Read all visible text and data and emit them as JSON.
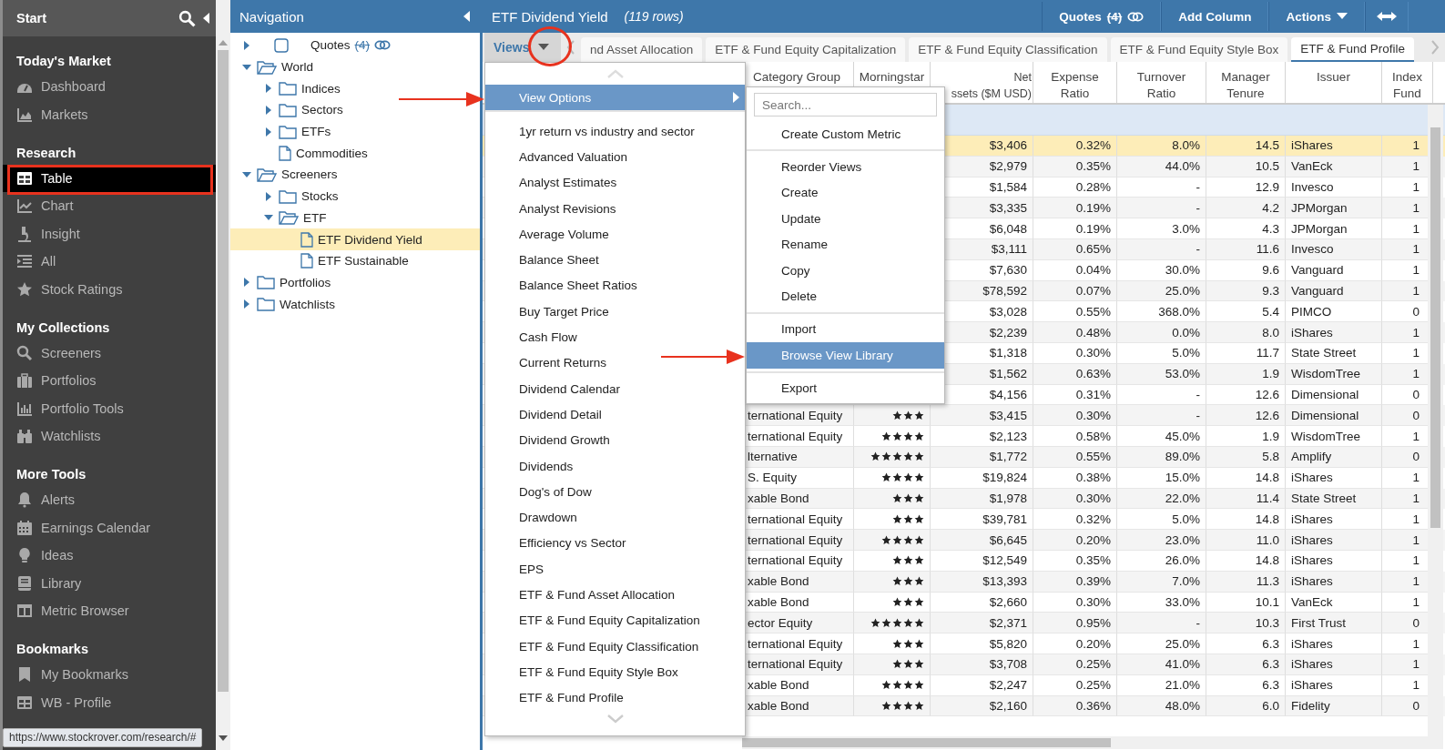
{
  "sidebar": {
    "title": "Start",
    "sections": [
      {
        "heading": "Today's Market",
        "items": [
          {
            "label": "Dashboard",
            "selected": false
          },
          {
            "label": "Markets",
            "selected": false
          }
        ]
      },
      {
        "heading": "Research",
        "items": [
          {
            "label": "Table",
            "selected": true
          },
          {
            "label": "Chart",
            "selected": false
          },
          {
            "label": "Insight",
            "selected": false
          },
          {
            "label": "All",
            "selected": false
          },
          {
            "label": "Stock Ratings",
            "selected": false
          }
        ]
      },
      {
        "heading": "My Collections",
        "items": [
          {
            "label": "Screeners",
            "selected": false
          },
          {
            "label": "Portfolios",
            "selected": false
          },
          {
            "label": "Portfolio Tools",
            "selected": false
          },
          {
            "label": "Watchlists",
            "selected": false
          }
        ]
      },
      {
        "heading": "More Tools",
        "items": [
          {
            "label": "Alerts",
            "selected": false
          },
          {
            "label": "Earnings Calendar",
            "selected": false
          },
          {
            "label": "Ideas",
            "selected": false
          },
          {
            "label": "Library",
            "selected": false
          },
          {
            "label": "Metric Browser",
            "selected": false
          }
        ]
      },
      {
        "heading": "Bookmarks",
        "items": [
          {
            "label": "My Bookmarks",
            "selected": false
          },
          {
            "label": "WB - Profile",
            "selected": false
          }
        ]
      }
    ]
  },
  "status_url": "https://www.stockrover.com/research/#",
  "navigation": {
    "title": "Navigation",
    "tree": [
      {
        "kind": "quotes",
        "label": "Quotes",
        "count": "(4)",
        "checked": false,
        "expanded": false,
        "selected": false
      },
      {
        "kind": "folder",
        "label": "World",
        "expanded": true,
        "selected": false,
        "children": [
          {
            "kind": "folder",
            "label": "Indices",
            "expanded": false,
            "selected": false
          },
          {
            "kind": "folder",
            "label": "Sectors",
            "expanded": false,
            "selected": false
          },
          {
            "kind": "folder",
            "label": "ETFs",
            "expanded": false,
            "selected": false
          },
          {
            "kind": "file",
            "label": "Commodities",
            "selected": false
          }
        ]
      },
      {
        "kind": "folder",
        "label": "Screeners",
        "expanded": true,
        "selected": false,
        "children": [
          {
            "kind": "folder",
            "label": "Stocks",
            "expanded": false,
            "selected": false
          },
          {
            "kind": "folder",
            "label": "ETF",
            "expanded": true,
            "selected": false,
            "children": [
              {
                "kind": "file",
                "label": "ETF Dividend Yield",
                "selected": true
              },
              {
                "kind": "file",
                "label": "ETF Sustainable",
                "selected": false
              }
            ]
          }
        ]
      },
      {
        "kind": "folder",
        "label": "Portfolios",
        "expanded": false,
        "selected": false
      },
      {
        "kind": "folder",
        "label": "Watchlists",
        "expanded": false,
        "selected": false
      }
    ]
  },
  "main": {
    "title": "ETF Dividend Yield",
    "row_count": "(119 rows)",
    "buttons": [
      {
        "kind": "quotes",
        "label": "Quotes",
        "count": "(4)"
      },
      {
        "kind": "plain",
        "label": "Add Column"
      },
      {
        "kind": "dropdown",
        "label": "Actions"
      },
      {
        "kind": "expand"
      }
    ]
  },
  "views_button": {
    "label": "Views"
  },
  "view_tabs": [
    {
      "label": "nd Asset Allocation",
      "selected": false
    },
    {
      "label": "ETF & Fund Equity Capitalization",
      "selected": false
    },
    {
      "label": "ETF & Fund Equity Classification",
      "selected": false
    },
    {
      "label": "ETF & Fund Equity Style Box",
      "selected": false
    },
    {
      "label": "ETF & Fund Profile",
      "selected": true
    }
  ],
  "table": {
    "columns": [
      {
        "lines": [
          "Category Group"
        ]
      },
      {
        "lines": [
          "Morningstar"
        ]
      },
      {
        "lines": [
          "Net",
          "ssets ($M USD)"
        ]
      },
      {
        "lines": [
          "Expense",
          "Ratio"
        ]
      },
      {
        "lines": [
          "Turnover",
          "Ratio"
        ]
      },
      {
        "lines": [
          "Manager",
          "Tenure"
        ]
      },
      {
        "lines": [
          "Issuer"
        ]
      },
      {
        "lines": [
          "Index",
          "Fund"
        ]
      }
    ],
    "rows": [
      {
        "selected": true,
        "net_assets": "$3,406",
        "expense": "0.32%",
        "turnover": "8.0%",
        "tenure": "14.5",
        "issuer": "iShares",
        "index": "1"
      },
      {
        "selected": false,
        "net_assets": "$2,979",
        "expense": "0.35%",
        "turnover": "44.0%",
        "tenure": "10.5",
        "issuer": "VanEck",
        "index": "1"
      },
      {
        "selected": false,
        "net_assets": "$1,584",
        "expense": "0.28%",
        "turnover": "-",
        "tenure": "12.9",
        "issuer": "Invesco",
        "index": "1"
      },
      {
        "selected": false,
        "net_assets": "$3,335",
        "expense": "0.19%",
        "turnover": "-",
        "tenure": "4.2",
        "issuer": "JPMorgan",
        "index": "1"
      },
      {
        "selected": false,
        "net_assets": "$6,048",
        "expense": "0.19%",
        "turnover": "3.0%",
        "tenure": "4.3",
        "issuer": "JPMorgan",
        "index": "1"
      },
      {
        "selected": false,
        "net_assets": "$3,111",
        "expense": "0.65%",
        "turnover": "-",
        "tenure": "11.6",
        "issuer": "Invesco",
        "index": "1"
      },
      {
        "selected": false,
        "net_assets": "$7,630",
        "expense": "0.04%",
        "turnover": "30.0%",
        "tenure": "9.6",
        "issuer": "Vanguard",
        "index": "1"
      },
      {
        "selected": false,
        "net_assets": "$78,592",
        "expense": "0.07%",
        "turnover": "25.0%",
        "tenure": "9.3",
        "issuer": "Vanguard",
        "index": "1"
      },
      {
        "selected": false,
        "net_assets": "$3,028",
        "expense": "0.55%",
        "turnover": "368.0%",
        "tenure": "5.4",
        "issuer": "PIMCO",
        "index": "0"
      },
      {
        "selected": false,
        "net_assets": "$2,239",
        "expense": "0.48%",
        "turnover": "0.0%",
        "tenure": "8.0",
        "issuer": "iShares",
        "index": "1"
      },
      {
        "selected": false,
        "net_assets": "$1,318",
        "expense": "0.30%",
        "turnover": "5.0%",
        "tenure": "11.7",
        "issuer": "State Street",
        "index": "1"
      },
      {
        "selected": false,
        "net_assets": "$1,562",
        "expense": "0.63%",
        "turnover": "53.0%",
        "tenure": "1.9",
        "issuer": "WisdomTree",
        "index": "1"
      },
      {
        "selected": false,
        "net_assets": "$4,156",
        "expense": "0.31%",
        "turnover": "-",
        "tenure": "12.6",
        "issuer": "Dimensional",
        "index": "0"
      },
      {
        "selected": false,
        "category": "ternational Equity",
        "stars": 3,
        "net_assets": "$3,415",
        "expense": "0.30%",
        "turnover": "-",
        "tenure": "12.6",
        "issuer": "Dimensional",
        "index": "0"
      },
      {
        "selected": false,
        "category": "ternational Equity",
        "stars": 4,
        "net_assets": "$2,123",
        "expense": "0.58%",
        "turnover": "45.0%",
        "tenure": "1.9",
        "issuer": "WisdomTree",
        "index": "1"
      },
      {
        "selected": false,
        "category": "lternative",
        "stars": 5,
        "net_assets": "$1,772",
        "expense": "0.55%",
        "turnover": "89.0%",
        "tenure": "5.8",
        "issuer": "Amplify",
        "index": "0"
      },
      {
        "selected": false,
        "category": "S. Equity",
        "stars": 4,
        "net_assets": "$19,824",
        "expense": "0.38%",
        "turnover": "15.0%",
        "tenure": "14.8",
        "issuer": "iShares",
        "index": "1"
      },
      {
        "selected": false,
        "category": "xable Bond",
        "stars": 3,
        "net_assets": "$1,978",
        "expense": "0.30%",
        "turnover": "22.0%",
        "tenure": "11.4",
        "issuer": "State Street",
        "index": "1"
      },
      {
        "selected": false,
        "category": "ternational Equity",
        "stars": 3,
        "net_assets": "$39,781",
        "expense": "0.32%",
        "turnover": "5.0%",
        "tenure": "14.8",
        "issuer": "iShares",
        "index": "1"
      },
      {
        "selected": false,
        "category": "ternational Equity",
        "stars": 4,
        "net_assets": "$6,645",
        "expense": "0.20%",
        "turnover": "23.0%",
        "tenure": "11.0",
        "issuer": "iShares",
        "index": "1"
      },
      {
        "selected": false,
        "category": "ternational Equity",
        "stars": 3,
        "net_assets": "$12,549",
        "expense": "0.35%",
        "turnover": "26.0%",
        "tenure": "14.8",
        "issuer": "iShares",
        "index": "1"
      },
      {
        "selected": false,
        "category": "xable Bond",
        "stars": 3,
        "net_assets": "$13,393",
        "expense": "0.39%",
        "turnover": "7.0%",
        "tenure": "11.3",
        "issuer": "iShares",
        "index": "1"
      },
      {
        "selected": false,
        "category": "xable Bond",
        "stars": 3,
        "net_assets": "$2,660",
        "expense": "0.30%",
        "turnover": "33.0%",
        "tenure": "10.1",
        "issuer": "VanEck",
        "index": "1"
      },
      {
        "selected": false,
        "category": "ector Equity",
        "stars": 5,
        "net_assets": "$2,371",
        "expense": "0.95%",
        "turnover": "-",
        "tenure": "10.3",
        "issuer": "First Trust",
        "index": "0"
      },
      {
        "selected": false,
        "category": "ternational Equity",
        "stars": 3,
        "net_assets": "$5,820",
        "expense": "0.20%",
        "turnover": "25.0%",
        "tenure": "6.3",
        "issuer": "iShares",
        "index": "1"
      },
      {
        "selected": false,
        "category": "ternational Equity",
        "stars": 3,
        "net_assets": "$3,708",
        "expense": "0.25%",
        "turnover": "41.0%",
        "tenure": "6.3",
        "issuer": "iShares",
        "index": "1"
      },
      {
        "selected": false,
        "category": "xable Bond",
        "stars": 4,
        "net_assets": "$2,247",
        "expense": "0.25%",
        "turnover": "21.0%",
        "tenure": "6.3",
        "issuer": "iShares",
        "index": "1"
      },
      {
        "selected": false,
        "category": "xable Bond",
        "stars": 4,
        "net_assets": "$2,160",
        "expense": "0.36%",
        "turnover": "48.0%",
        "tenure": "6.0",
        "issuer": "Fidelity",
        "index": "0"
      }
    ]
  },
  "views_menu": {
    "view_options": {
      "label": "View Options",
      "selected": true
    },
    "items": [
      "1yr return vs industry and sector",
      "Advanced Valuation",
      "Analyst Estimates",
      "Analyst Revisions",
      "Average Volume",
      "Balance Sheet",
      "Balance Sheet Ratios",
      "Buy Target Price",
      "Cash Flow",
      "Current Returns",
      "Dividend Calendar",
      "Dividend Detail",
      "Dividend Growth",
      "Dividends",
      "Dog's of Dow",
      "Drawdown",
      "Efficiency vs Sector",
      "EPS",
      "ETF & Fund Asset Allocation",
      "ETF & Fund Equity Capitalization",
      "ETF & Fund Equity Classification",
      "ETF & Fund Equity Style Box",
      "ETF & Fund Profile"
    ]
  },
  "view_options_menu": {
    "search": {
      "placeholder": "Search..."
    },
    "groups": [
      [
        {
          "label": "Create Custom Metric",
          "selected": false
        }
      ],
      [
        {
          "label": "Reorder Views",
          "selected": false
        },
        {
          "label": "Create",
          "selected": false
        },
        {
          "label": "Update",
          "selected": false
        },
        {
          "label": "Rename",
          "selected": false
        },
        {
          "label": "Copy",
          "selected": false
        },
        {
          "label": "Delete",
          "selected": false
        }
      ],
      [
        {
          "label": "Import",
          "selected": false
        },
        {
          "label": "Browse View Library",
          "selected": true
        }
      ],
      [
        {
          "label": "Export",
          "selected": false
        }
      ]
    ]
  }
}
